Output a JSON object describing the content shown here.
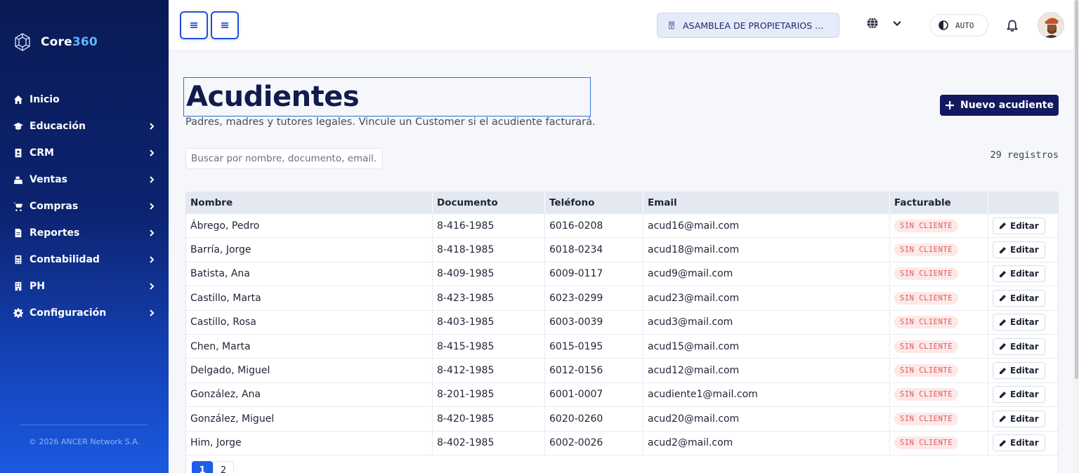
{
  "brand": {
    "name_a": "Core",
    "name_b": "360"
  },
  "sidebar": {
    "items": [
      {
        "label": "Inicio",
        "icon": "home-icon",
        "has_children": false
      },
      {
        "label": "Educación",
        "icon": "graduation-cap-icon",
        "has_children": true
      },
      {
        "label": "CRM",
        "icon": "contact-card-icon",
        "has_children": true
      },
      {
        "label": "Ventas",
        "icon": "cash-register-icon",
        "has_children": true
      },
      {
        "label": "Compras",
        "icon": "cart-icon",
        "has_children": true
      },
      {
        "label": "Reportes",
        "icon": "file-report-icon",
        "has_children": true
      },
      {
        "label": "Contabilidad",
        "icon": "calculator-icon",
        "has_children": true
      },
      {
        "label": "PH",
        "icon": "building-icon",
        "has_children": true
      },
      {
        "label": "Configuración",
        "icon": "gear-icon",
        "has_children": true
      }
    ],
    "copyright": "© 2026 ANCER Network S.A."
  },
  "topbar": {
    "org": "ASAMBLEA DE PROPIETARIOS DE PH ...",
    "theme_label": "AUTO"
  },
  "page": {
    "title": "Acudientes",
    "subtitle": "Padres, madres y tutores legales. Vincule un Customer si el acudiente facturará.",
    "new_button": "Nuevo acudiente",
    "search_placeholder": "Buscar por nombre, documento, email...",
    "count": "29 registros"
  },
  "table": {
    "columns": [
      "Nombre",
      "Documento",
      "Teléfono",
      "Email",
      "Facturable",
      ""
    ],
    "rows": [
      {
        "nombre": "Ábrego, Pedro",
        "documento": "8-416-1985",
        "telefono": "6016-0208",
        "email": "acud16@mail.com",
        "facturable": "SIN CLIENTE",
        "action": "Editar"
      },
      {
        "nombre": "Barría, Jorge",
        "documento": "8-418-1985",
        "telefono": "6018-0234",
        "email": "acud18@mail.com",
        "facturable": "SIN CLIENTE",
        "action": "Editar"
      },
      {
        "nombre": "Batista, Ana",
        "documento": "8-409-1985",
        "telefono": "6009-0117",
        "email": "acud9@mail.com",
        "facturable": "SIN CLIENTE",
        "action": "Editar"
      },
      {
        "nombre": "Castillo, Marta",
        "documento": "8-423-1985",
        "telefono": "6023-0299",
        "email": "acud23@mail.com",
        "facturable": "SIN CLIENTE",
        "action": "Editar"
      },
      {
        "nombre": "Castillo, Rosa",
        "documento": "8-403-1985",
        "telefono": "6003-0039",
        "email": "acud3@mail.com",
        "facturable": "SIN CLIENTE",
        "action": "Editar"
      },
      {
        "nombre": "Chen, Marta",
        "documento": "8-415-1985",
        "telefono": "6015-0195",
        "email": "acud15@mail.com",
        "facturable": "SIN CLIENTE",
        "action": "Editar"
      },
      {
        "nombre": "Delgado, Miguel",
        "documento": "8-412-1985",
        "telefono": "6012-0156",
        "email": "acud12@mail.com",
        "facturable": "SIN CLIENTE",
        "action": "Editar"
      },
      {
        "nombre": "González, Ana",
        "documento": "8-201-1985",
        "telefono": "6001-0007",
        "email": "acudiente1@mail.com",
        "facturable": "SIN CLIENTE",
        "action": "Editar"
      },
      {
        "nombre": "González, Miguel",
        "documento": "8-420-1985",
        "telefono": "6020-0260",
        "email": "acud20@mail.com",
        "facturable": "SIN CLIENTE",
        "action": "Editar"
      },
      {
        "nombre": "Him, Jorge",
        "documento": "8-402-1985",
        "telefono": "6002-0026",
        "email": "acud2@mail.com",
        "facturable": "SIN CLIENTE",
        "action": "Editar"
      }
    ]
  },
  "pagination": {
    "pages": [
      "1",
      "2"
    ],
    "current": "1"
  },
  "colors": {
    "sidebar_top": "#0a1a55",
    "sidebar_bottom": "#1a5ae0",
    "primary": "#12195e",
    "accent": "#1f5ee8",
    "badge_text": "#e05a5a",
    "badge_bg": "#fde8e8"
  }
}
